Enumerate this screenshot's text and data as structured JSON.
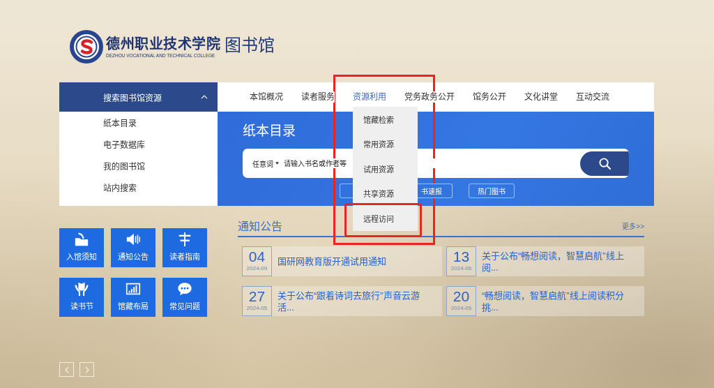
{
  "header": {
    "college_name": "德州职业技术学院",
    "college_name_en": "DEZHOU VOCATIONAL AND TECHNICAL COLLEGE",
    "site_name": "图书馆"
  },
  "sidebar": {
    "title": "搜索图书馆资源",
    "expanded": true,
    "items": [
      {
        "label": "纸本目录"
      },
      {
        "label": "电子数据库"
      },
      {
        "label": "我的图书馆"
      },
      {
        "label": "站内搜索"
      }
    ]
  },
  "nav": {
    "items": [
      {
        "label": "本馆概况",
        "selected": false,
        "highlighted": false
      },
      {
        "label": "读者服务",
        "selected": false,
        "highlighted": false
      },
      {
        "label": "资源利用",
        "selected": true,
        "highlighted": true,
        "menu": [
          {
            "label": "馆藏检索",
            "highlighted": false
          },
          {
            "label": "常用资源",
            "highlighted": false
          },
          {
            "label": "试用资源",
            "highlighted": false
          },
          {
            "label": "共享资源",
            "highlighted": false
          },
          {
            "label": "远程访问",
            "highlighted": true
          }
        ]
      },
      {
        "label": "党务政务公开",
        "selected": false,
        "highlighted": false
      },
      {
        "label": "馆务公开",
        "selected": false,
        "highlighted": false
      },
      {
        "label": "文化讲堂",
        "selected": false,
        "highlighted": false
      },
      {
        "label": "互动交流",
        "selected": false,
        "highlighted": false
      }
    ]
  },
  "banner": {
    "title": "纸本目录",
    "search": {
      "scope": "任意词",
      "placeholder": "请输入书名或作者等"
    },
    "tags": [
      {
        "kind": "cut_right"
      },
      {
        "kind": "cut_left",
        "label": "书速报"
      },
      {
        "kind": "full",
        "label": "热门图书"
      }
    ]
  },
  "quick_links": [
    {
      "label": "入馆须知"
    },
    {
      "label": "通知公告"
    },
    {
      "label": "读者指南"
    },
    {
      "label": "读书节"
    },
    {
      "label": "馆藏布局"
    },
    {
      "label": "常见问题"
    }
  ],
  "notices": {
    "title": "通知公告",
    "more": "更多>>",
    "items": [
      {
        "day": "04",
        "month": "2024-09",
        "title": "国研网教育版开通试用通知"
      },
      {
        "day": "13",
        "month": "2024-06",
        "title": "关于公布“畅想阅读，智慧启航”线上阅..."
      },
      {
        "day": "27",
        "month": "2024-05",
        "title": "关于公布“跟着诗词去旅行”声音云游活..."
      },
      {
        "day": "20",
        "month": "2024-05",
        "title": "“畅想阅读，智慧启航”线上阅读积分挑..."
      }
    ]
  }
}
